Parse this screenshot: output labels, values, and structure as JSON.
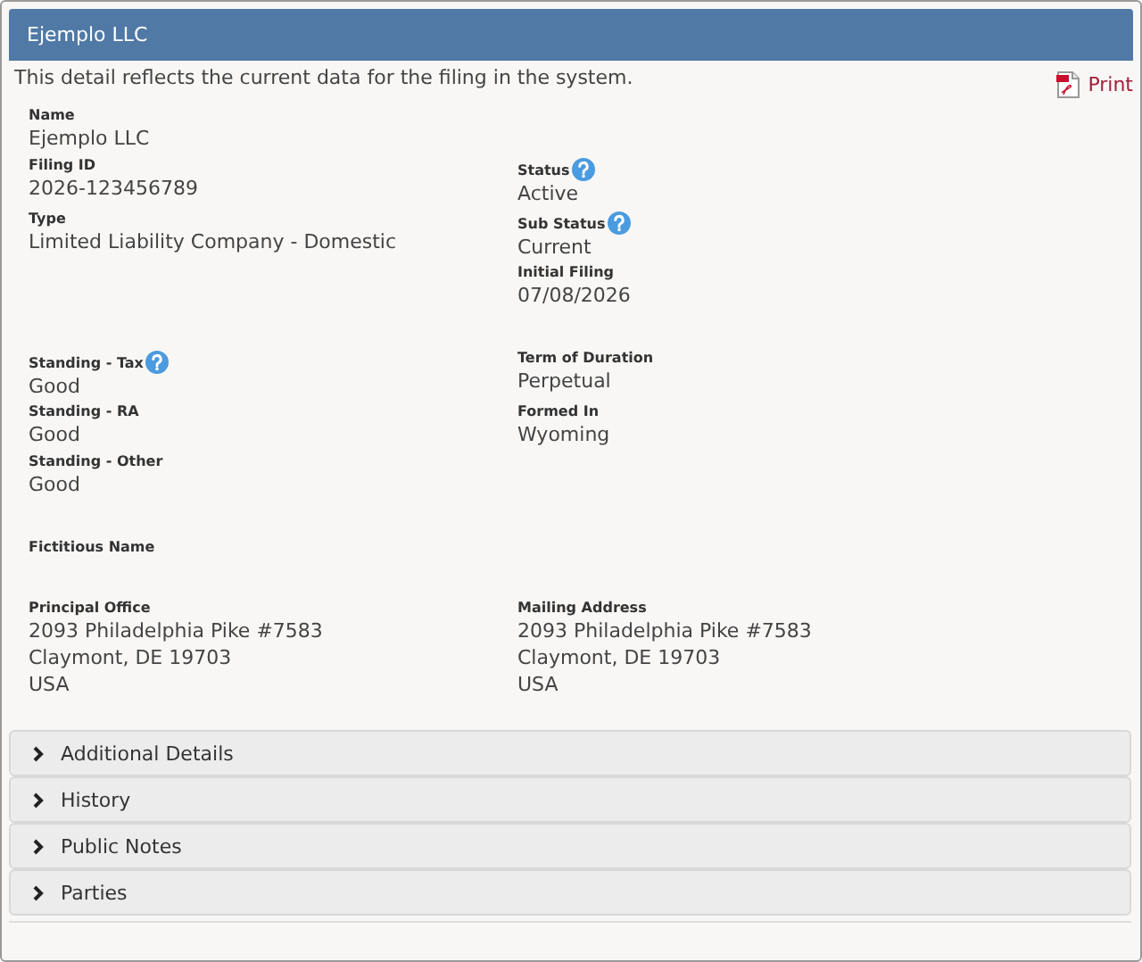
{
  "header": {
    "title": "Ejemplo LLC"
  },
  "intro": "This detail reflects the current data for the filing in the system.",
  "print_link": "Print",
  "groups": [
    [
      {
        "left": {
          "label": "Name",
          "help": false,
          "lines": [
            "Ejemplo LLC"
          ]
        }
      },
      {
        "left": {
          "label": "Filing ID",
          "help": false,
          "lines": [
            "2026-123456789"
          ]
        },
        "right": {
          "label": "Status",
          "help": true,
          "lines": [
            "Active"
          ]
        }
      },
      {
        "left": {
          "label": "Type",
          "help": false,
          "lines": [
            "Limited Liability Company - Domestic"
          ]
        },
        "right": {
          "label": "Sub Status",
          "help": true,
          "lines": [
            "Current"
          ]
        }
      },
      {
        "right": {
          "label": "Initial Filing",
          "help": false,
          "lines": [
            "07/08/2026"
          ]
        }
      }
    ],
    [
      {
        "left": {
          "label": "Standing - Tax",
          "help": true,
          "lines": [
            "Good"
          ]
        },
        "right": {
          "label": "Term of Duration",
          "help": false,
          "lines": [
            "Perpetual"
          ]
        }
      },
      {
        "left": {
          "label": "Standing - RA",
          "help": false,
          "lines": [
            "Good"
          ]
        },
        "right": {
          "label": "Formed In",
          "help": false,
          "lines": [
            "Wyoming"
          ]
        }
      },
      {
        "left": {
          "label": "Standing - Other",
          "help": false,
          "lines": [
            "Good"
          ]
        }
      }
    ],
    [
      {
        "left": {
          "label": "Fictitious Name",
          "help": false
        }
      }
    ],
    [
      {
        "left": {
          "label": "Principal Office",
          "help": false,
          "lines": [
            "2093 Philadelphia Pike #7583",
            "Claymont, DE 19703",
            "USA"
          ]
        },
        "right": {
          "label": "Mailing Address",
          "help": false,
          "lines": [
            "2093 Philadelphia Pike #7583",
            "Claymont, DE 19703",
            "USA"
          ]
        }
      }
    ]
  ],
  "accordion": [
    {
      "label": "Additional Details",
      "expanded": false
    },
    {
      "label": "History",
      "expanded": false
    },
    {
      "label": "Public Notes",
      "expanded": false
    },
    {
      "label": "Parties",
      "expanded": false
    }
  ]
}
